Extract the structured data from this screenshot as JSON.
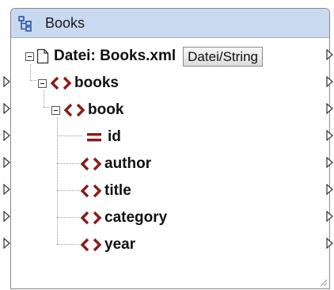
{
  "component": {
    "title": "Books",
    "title_icon": "xml-schema-icon"
  },
  "file_row": {
    "label": "Datei: Books.xml",
    "button_label": "Datei/String",
    "icon": "file-icon"
  },
  "tree": [
    {
      "label": "books",
      "kind": "element",
      "expanded": true
    },
    {
      "label": "book",
      "kind": "element",
      "expanded": true
    },
    {
      "label": "id",
      "kind": "attribute"
    },
    {
      "label": "author",
      "kind": "element"
    },
    {
      "label": "title",
      "kind": "element"
    },
    {
      "label": "category",
      "kind": "element"
    },
    {
      "label": "year",
      "kind": "element"
    }
  ],
  "colors": {
    "title_bg": "#c9d9ef",
    "element_icon": "#8b1a1a",
    "border": "#8a8a8a"
  }
}
